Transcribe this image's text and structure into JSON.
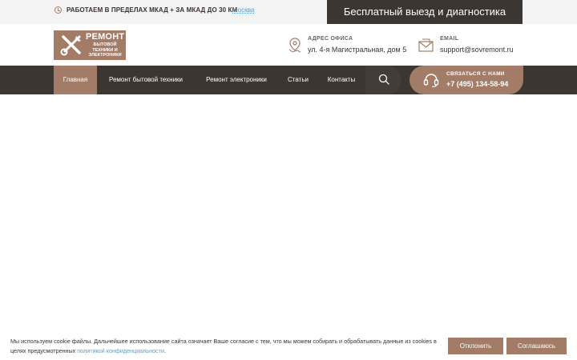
{
  "topbar": {
    "work_area": "РАБОТАЕМ В ПРЕДЕЛАХ МКАД + ЗА МКАД ДО 30 КМ",
    "city": "Москва",
    "promo": "Бесплатный выезд и диагностика"
  },
  "logo": {
    "title": "РЕМОНТ",
    "subtitle": "БЫТОВОЙ ТЕХНИКИ И ЭЛЕКТРОНИКИ"
  },
  "header": {
    "address_label": "АДРЕС ОФИСА",
    "address_value": "ул. 4-я Магистральная, дом 5",
    "email_label": "EMAIL",
    "email_value": "support@sovremont.ru"
  },
  "nav": {
    "items": [
      {
        "label": "Главная"
      },
      {
        "label": "Ремонт бытовой техники"
      },
      {
        "label": "Ремонт электроники"
      },
      {
        "label": "Статьи"
      },
      {
        "label": "Контакты"
      }
    ]
  },
  "contact": {
    "label": "СВЯЗАТЬСЯ С НАМИ",
    "phone": "+7 (495) 134-58-94"
  },
  "cookie": {
    "text_before": "Мы используем cookie файлы. Дальнейшее использование сайта означает Ваше согласие с тем, что мы можем собирать и обрабатывать данные из cookies в целях предусмотренных",
    "link": "политикой конфиденциальности",
    "text_after": ".",
    "decline": "Отклонить",
    "accept": "Соглашаюсь"
  },
  "colors": {
    "accent": "#a37c67",
    "dark": "#3c3633",
    "hero": "#918c89",
    "link": "#5a9fd0"
  }
}
